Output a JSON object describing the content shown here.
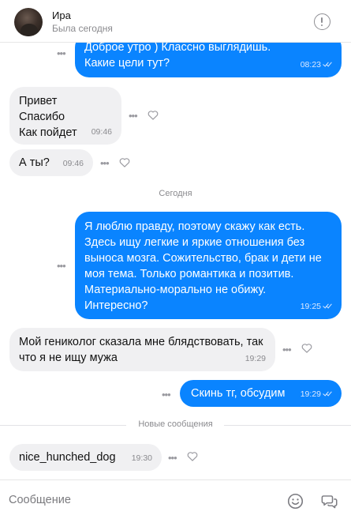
{
  "header": {
    "contact_name": "Ира",
    "status": "Была сегодня",
    "info_icon": "info-circle-icon"
  },
  "messages": [
    {
      "dir": "out",
      "text": "Доброе утро ) Классно выглядишь. Какие цели тут?",
      "time": "08:23",
      "read": true
    },
    {
      "dir": "in",
      "text": "Привет\nСпасибо\nКак пойдет",
      "time": "09:46"
    },
    {
      "dir": "in",
      "text": "А ты?",
      "time": "09:46"
    },
    {
      "dir": "out",
      "text": "Я люблю правду, поэтому скажу как есть. Здесь ищу легкие и яркие отношения без выноса мозга. Сожительство, брак и дети не моя тема. Только романтика и позитив. Материально-морально не обижу. Интересно?",
      "time": "19:25",
      "read": true
    },
    {
      "dir": "in",
      "text": "Мой геникoлог сказала мне блядствовать, так что я не ищу мужа",
      "time": "19:29"
    },
    {
      "dir": "out",
      "text": "Скинь тг, обсудим",
      "time": "19:29",
      "read": true
    },
    {
      "dir": "in",
      "text": "nice_hunched_dog",
      "time": "19:30"
    }
  ],
  "dividers": {
    "today": "Сегодня",
    "new_messages": "Новые сообщения"
  },
  "composer": {
    "placeholder": "Сообщение",
    "emoji_icon": "emoji-smile-icon",
    "sticker_icon": "chat-bubbles-icon"
  },
  "colors": {
    "outgoing_bubble": "#0a84ff",
    "incoming_bubble": "#f0f0f2"
  }
}
